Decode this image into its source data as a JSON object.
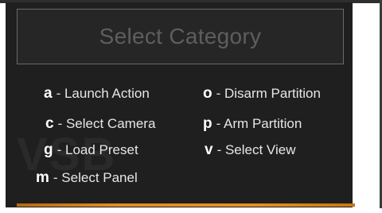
{
  "dialog": {
    "title": "Select Category",
    "accent_color": "#e58f1f"
  },
  "shortcuts": [
    {
      "key": "a",
      "label": "- Launch Action"
    },
    {
      "key": "c",
      "label": "- Select Camera"
    },
    {
      "key": "g",
      "label": "- Load Preset"
    },
    {
      "key": "m",
      "label": "- Select Panel"
    },
    {
      "key": "o",
      "label": "- Disarm Partition"
    },
    {
      "key": "p",
      "label": "- Arm Partition"
    },
    {
      "key": "v",
      "label": "- Select View"
    }
  ]
}
